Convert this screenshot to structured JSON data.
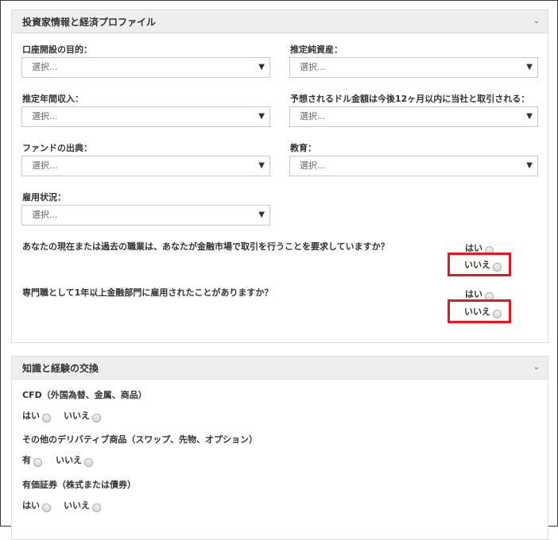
{
  "profile": {
    "header": "投資家情報と経済プロファイル",
    "fields": {
      "purpose": {
        "label": "口座開設の目的：",
        "value": "選択..."
      },
      "net_assets": {
        "label": "推定純資産：",
        "value": "選択..."
      },
      "annual_income": {
        "label": "推定年間収入：",
        "value": "選択..."
      },
      "expected_amount": {
        "label": "予想されるドル金額は今後12ヶ月以内に当社と取引される：",
        "value": "選択..."
      },
      "fund_source": {
        "label": "ファンドの出典：",
        "value": "選択..."
      },
      "education": {
        "label": "教育：",
        "value": "選択..."
      },
      "employment": {
        "label": "雇用状況：",
        "value": "選択..."
      }
    },
    "questions": [
      {
        "text": "あなたの現在または過去の職業は、あなたが金融市場で取引を行うことを要求していますか？",
        "yes": "はい",
        "no": "いいえ"
      },
      {
        "text": "専門職として1年以上金融部門に雇用されたことがありますか？",
        "yes": "はい",
        "no": "いいえ"
      }
    ]
  },
  "knowledge": {
    "header": "知識と経験の交換",
    "items": [
      {
        "title": "CFD（外国為替、金属、商品）",
        "yes": "はい",
        "no": "いいえ"
      },
      {
        "title": "その他のデリバティブ商品（スワップ、先物、オプション）",
        "yes": "有",
        "no": "いいえ"
      },
      {
        "title": "有価証券（株式または債券）",
        "yes": "はい",
        "no": "いいえ"
      }
    ]
  },
  "highlight_color": "#e01a22"
}
